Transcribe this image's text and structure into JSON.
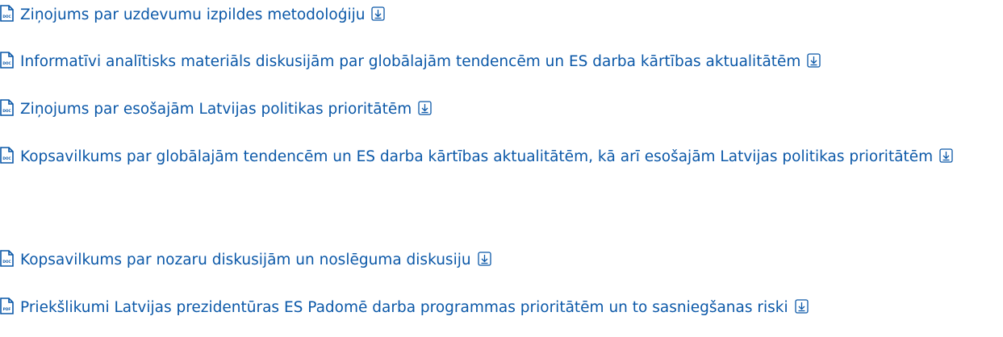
{
  "colors": {
    "link": "#0b58a8"
  },
  "documents": [
    {
      "type_label": "DOC",
      "title": "Ziņojums par uzdevumu izpildes metodoloģiju",
      "icon": "doc-file-icon",
      "action_icon": "download-icon"
    },
    {
      "type_label": "DOC",
      "title": "Informatīvi analītisks materiāls diskusijām par globālajām tendencēm un ES darba kārtības aktualitātēm",
      "icon": "doc-file-icon",
      "action_icon": "download-icon"
    },
    {
      "type_label": "DOC",
      "title": "Ziņojums par esošajām Latvijas politikas prioritātēm",
      "icon": "doc-file-icon",
      "action_icon": "download-icon"
    },
    {
      "type_label": "DOC",
      "title": "Kopsavilkums par globālajām tendencēm un ES darba kārtības aktualitātēm, kā arī esošajām Latvijas politikas prioritātēm",
      "icon": "doc-file-icon",
      "action_icon": "download-icon"
    },
    {
      "type_label": "DOC",
      "title": "Kopsavilkums par nozaru diskusijām un noslēguma diskusiju",
      "icon": "doc-file-icon",
      "action_icon": "download-icon"
    },
    {
      "type_label": "PDF",
      "title": "Priekšlikumi Latvijas prezidentūras ES Padomē darba programmas prioritātēm un to sasniegšanas riski",
      "icon": "pdf-file-icon",
      "action_icon": "download-icon"
    }
  ]
}
